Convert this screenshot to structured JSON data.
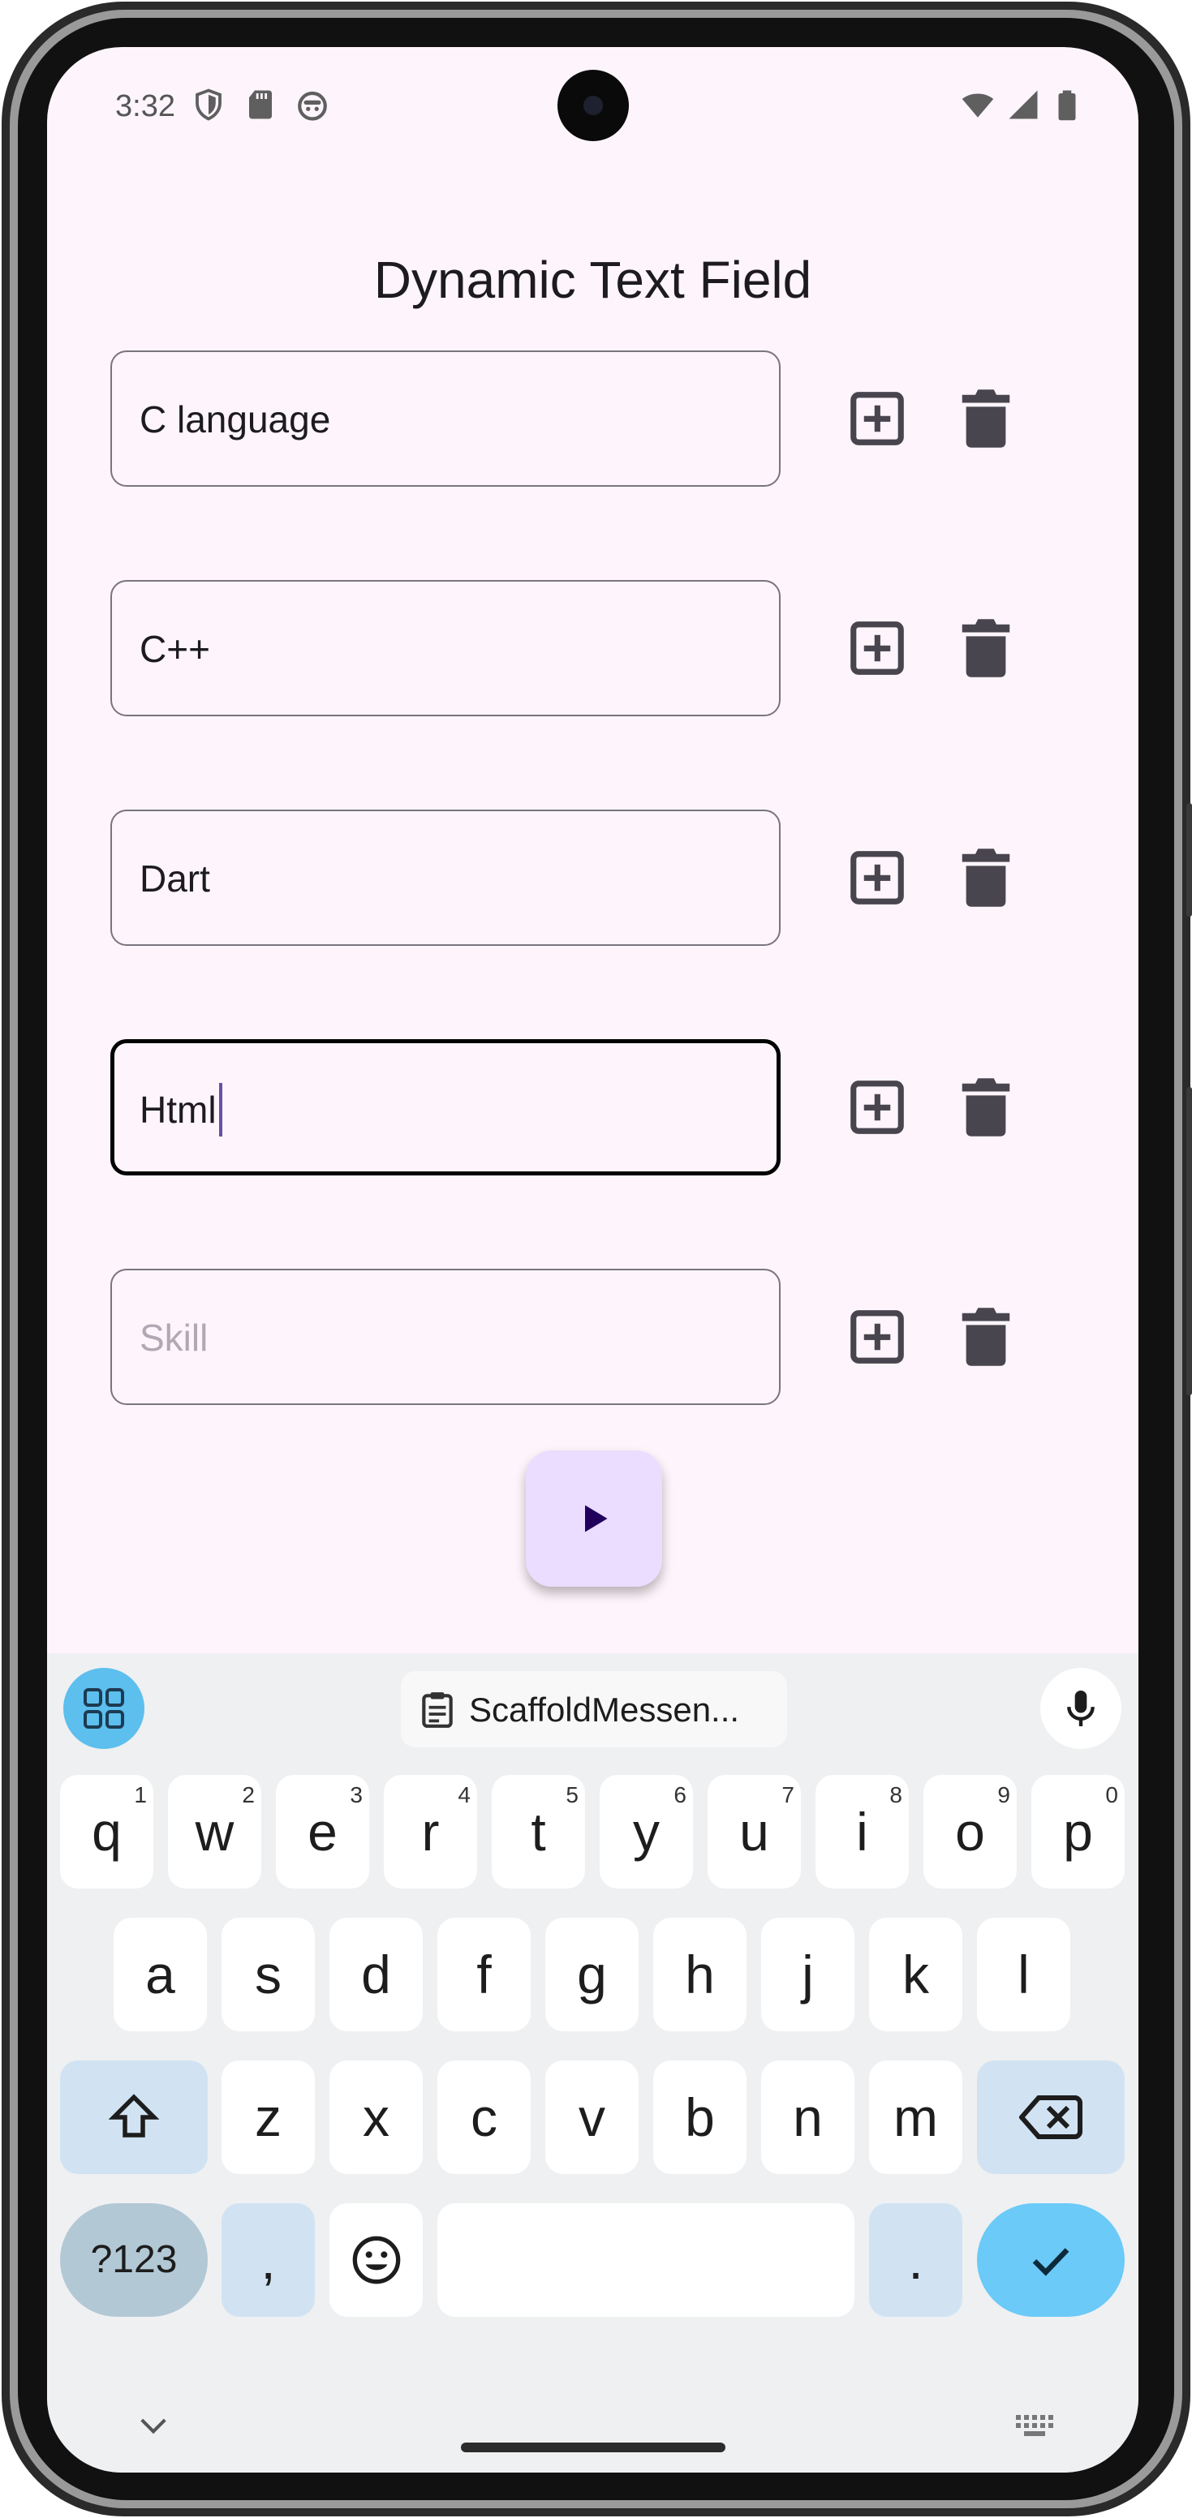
{
  "status_bar": {
    "time": "3:32",
    "left_icons": [
      "shield-icon",
      "sd-card-icon",
      "app-notification-icon"
    ],
    "right_icons": [
      "wifi-icon",
      "cellular-signal-icon",
      "battery-icon"
    ]
  },
  "app_bar": {
    "title": "Dynamic Text Field"
  },
  "fields": [
    {
      "value": "C language",
      "placeholder": "Skill",
      "focused": false
    },
    {
      "value": "C++",
      "placeholder": "Skill",
      "focused": false
    },
    {
      "value": "Dart",
      "placeholder": "Skill",
      "focused": false
    },
    {
      "value": "Html",
      "placeholder": "Skill",
      "focused": true
    },
    {
      "value": "",
      "placeholder": "Skill",
      "focused": false
    }
  ],
  "row_icons": {
    "add": "add-box-icon",
    "delete": "delete-icon"
  },
  "fab": {
    "icon": "play-arrow-icon"
  },
  "keyboard": {
    "clipboard_suggestion": "ScaffoldMessen...",
    "row1": [
      {
        "label": "q",
        "hint": "1"
      },
      {
        "label": "w",
        "hint": "2"
      },
      {
        "label": "e",
        "hint": "3"
      },
      {
        "label": "r",
        "hint": "4"
      },
      {
        "label": "t",
        "hint": "5"
      },
      {
        "label": "y",
        "hint": "6"
      },
      {
        "label": "u",
        "hint": "7"
      },
      {
        "label": "i",
        "hint": "8"
      },
      {
        "label": "o",
        "hint": "9"
      },
      {
        "label": "p",
        "hint": "0"
      }
    ],
    "row2": [
      "a",
      "s",
      "d",
      "f",
      "g",
      "h",
      "j",
      "k",
      "l"
    ],
    "row3": [
      "z",
      "x",
      "c",
      "v",
      "b",
      "n",
      "m"
    ],
    "symbols_label": "?123",
    "comma_label": ",",
    "period_label": "."
  },
  "colors": {
    "background": "#fdf5fb",
    "field_border": "#79747e",
    "focused_border": "#000000",
    "caret": "#6750a4",
    "fab_background": "#eaddff",
    "icon": "#49454f",
    "keyboard_accent": "#6bcaf7"
  }
}
